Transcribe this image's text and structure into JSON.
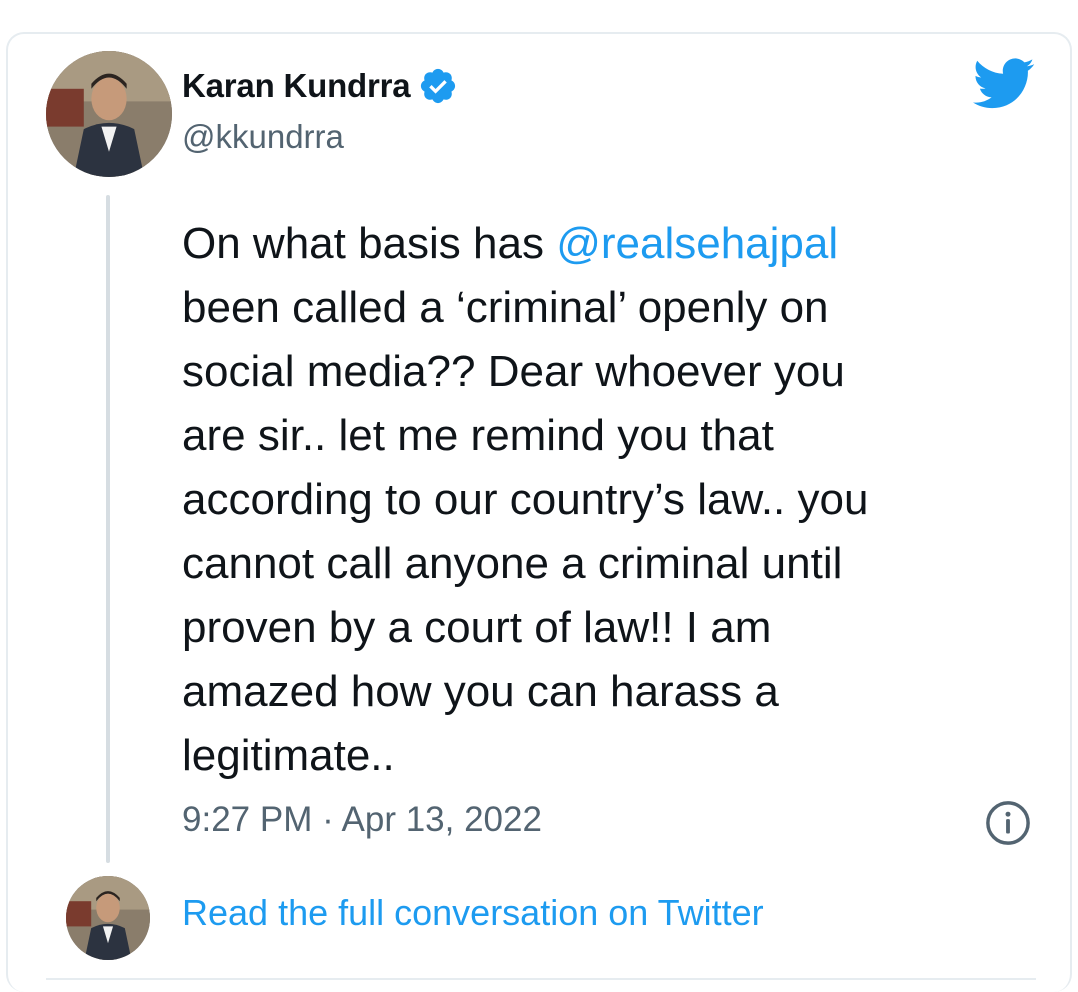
{
  "tweet": {
    "author_name": "Karan Kundrra",
    "author_handle": "@kkundrra",
    "verified_icon": "verified-badge-icon",
    "text_before_mention": "On what basis has ",
    "mention": "@realsehajpal",
    "text_after_mention": "\nbeen called a ‘criminal’ openly on\nsocial media?? Dear whoever you\nare sir.. let me remind you that\naccording to our country’s law.. you\ncannot call anyone a criminal until\nproven by a court of law!! I am\namazed how you can harass a\nlegitimate..",
    "timestamp": "9:27 PM · Apr 13, 2022"
  },
  "footer": {
    "read_conversation_label": "Read the full conversation on Twitter"
  },
  "icons": {
    "logo": "twitter-bird-icon",
    "info": "info-icon"
  },
  "colors": {
    "accent": "#1d9bf0",
    "text": "#0f1419",
    "secondary_text": "#536471",
    "border": "#e6ecf0"
  }
}
